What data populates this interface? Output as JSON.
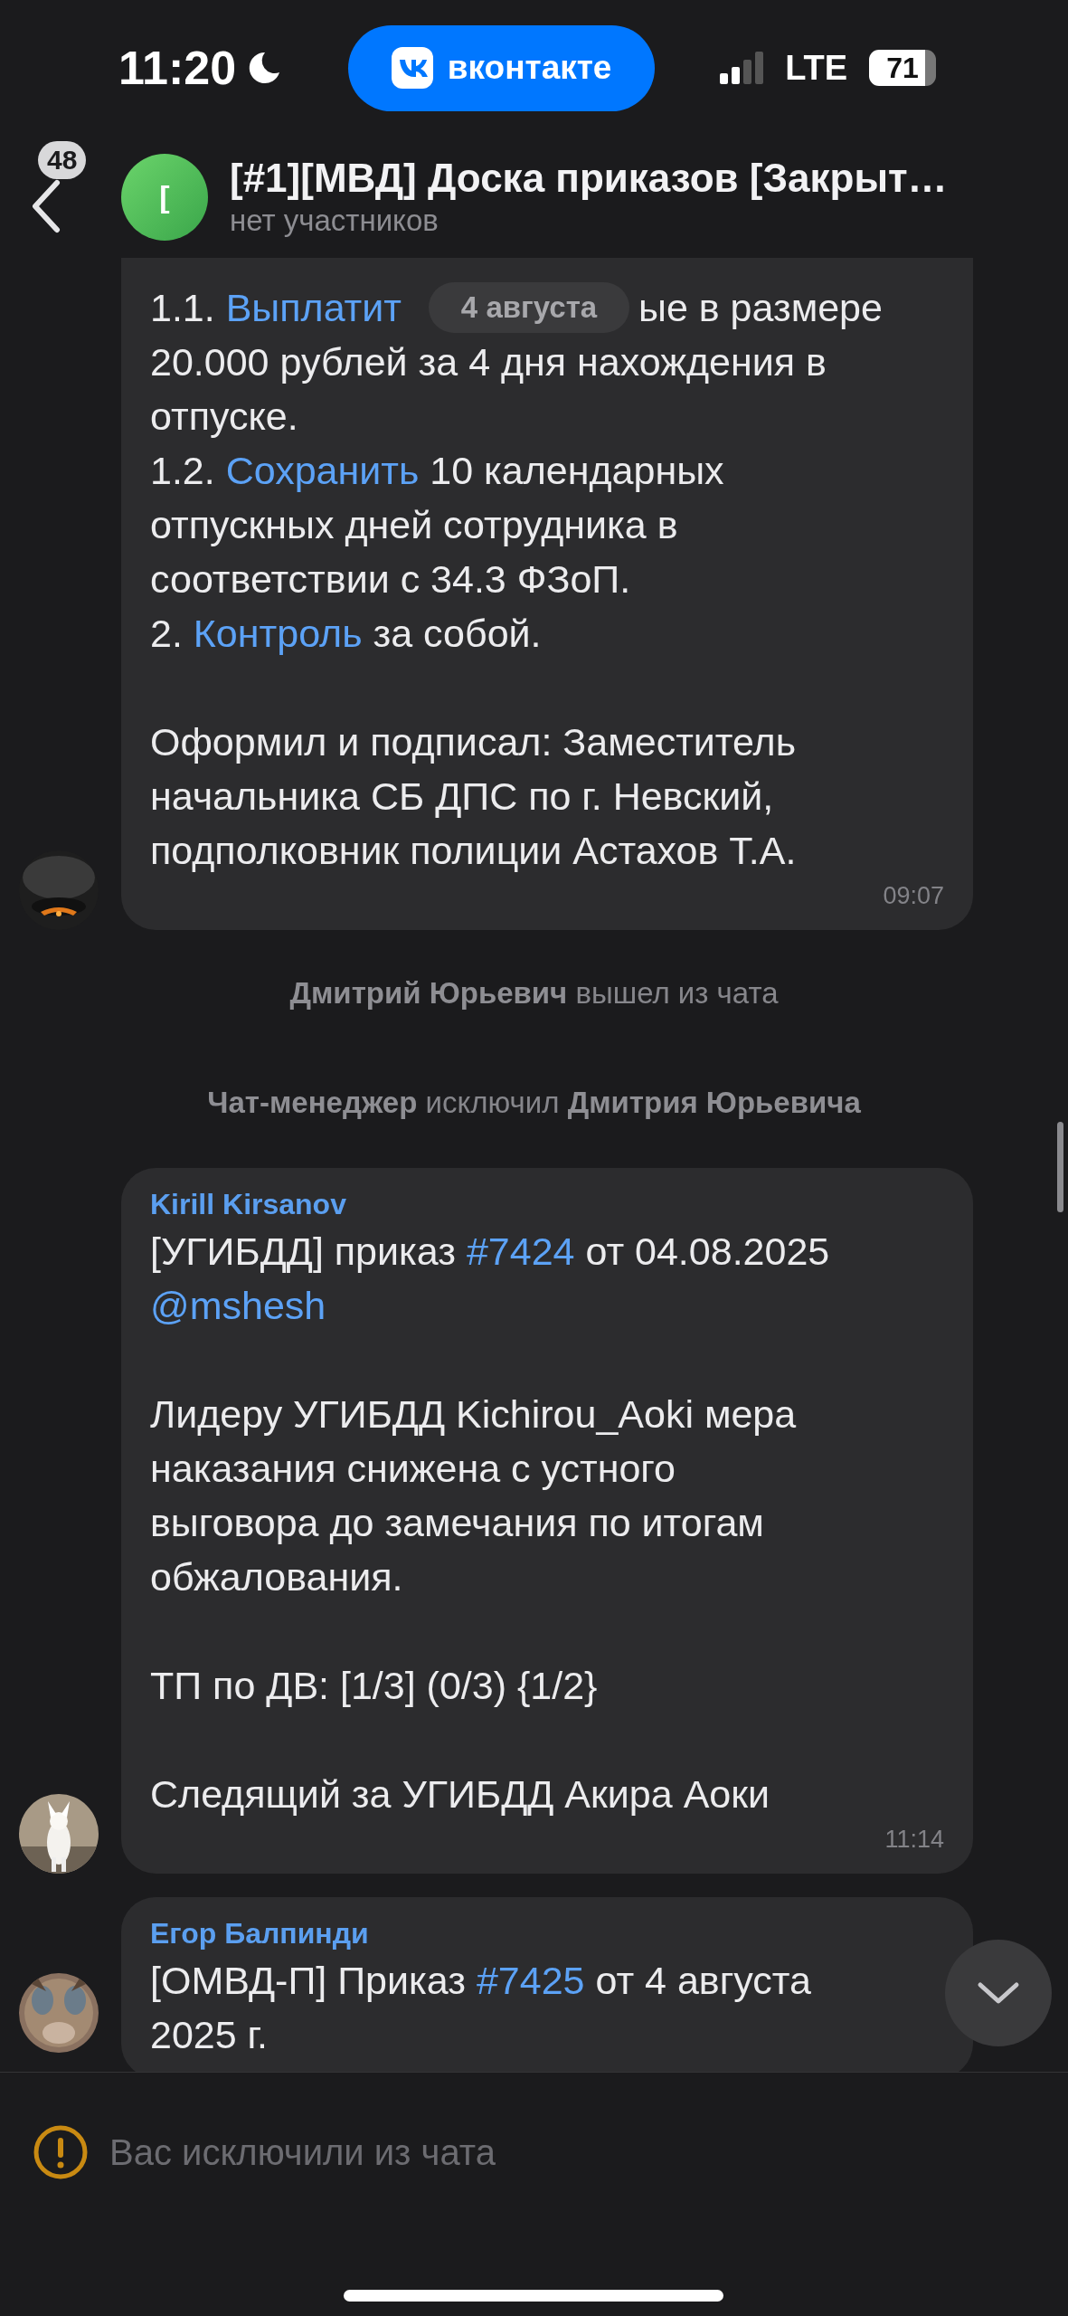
{
  "status_bar": {
    "time": "11:20",
    "app_pill": "вконтакте",
    "network": "LTE",
    "battery": "71"
  },
  "header": {
    "back_badge": "48",
    "avatar_letter": "[",
    "title": "[#1][МВД] Доска приказов [Закрыт…",
    "subtitle": "нет участников"
  },
  "date_pill": "4 августа",
  "feed": [
    {
      "kind": "message",
      "paragraphs": [
        [
          [
            {
              "kind": "text",
              "text": "1.1. "
            },
            {
              "kind": "link",
              "text": "Выплатит"
            },
            {
              "kind": "covered"
            },
            {
              "kind": "text",
              "text": "ые в размере"
            }
          ],
          [
            {
              "kind": "text",
              "text": "20.000 рублей за 4 дня нахождения в"
            }
          ],
          [
            {
              "kind": "text",
              "text": "отпуске."
            }
          ],
          [
            {
              "kind": "text",
              "text": "1.2. "
            },
            {
              "kind": "link",
              "text": "Сохранить"
            },
            {
              "kind": "text",
              "text": " 10 календарных"
            }
          ],
          [
            {
              "kind": "text",
              "text": "отпускных дней сотрудника в"
            }
          ],
          [
            {
              "kind": "text",
              "text": "соответствии с 34.3 ФЗоП."
            }
          ],
          [
            {
              "kind": "text",
              "text": "2. "
            },
            {
              "kind": "link",
              "text": "Контроль"
            },
            {
              "kind": "text",
              "text": " за собой."
            }
          ]
        ],
        [
          [
            {
              "kind": "text",
              "text": "Оформил и подписал: Заместитель"
            }
          ],
          [
            {
              "kind": "text",
              "text": "начальника СБ ДПС по г. Невский,"
            }
          ],
          [
            {
              "kind": "text",
              "text": "подполковник полиции Астахов Т.А."
            }
          ]
        ]
      ],
      "time": "09:07"
    },
    {
      "kind": "system",
      "text": "**Дмитрий Юрьевич** вышел из чата"
    },
    {
      "kind": "system",
      "text": "**Чат-менеджер** исключил **Дмитрия Юрьевича**"
    },
    {
      "kind": "message",
      "sender": "Kirill Kirsanov",
      "paragraphs": [
        [
          [
            {
              "kind": "text",
              "text": "[УГИБДД] приказ "
            },
            {
              "kind": "link",
              "text": "#7424"
            },
            {
              "kind": "text",
              "text": " от 04.08.2025"
            }
          ],
          [
            {
              "kind": "link",
              "text": "@mshesh"
            }
          ]
        ],
        [
          [
            {
              "kind": "text",
              "text": "Лидеру УГИБДД Kichirou_Aoki мера"
            }
          ],
          [
            {
              "kind": "text",
              "text": "наказания снижена с устного"
            }
          ],
          [
            {
              "kind": "text",
              "text": "выговора до замечания по итогам"
            }
          ],
          [
            {
              "kind": "text",
              "text": "обжалования."
            }
          ]
        ],
        [
          [
            {
              "kind": "text",
              "text": "ТП по ДВ: [1/3] (0/3) {1/2}"
            }
          ]
        ],
        [
          [
            {
              "kind": "text",
              "text": "Следящий за УГИБДД Акира Аоки"
            }
          ]
        ]
      ],
      "time": "11:14"
    },
    {
      "kind": "message",
      "sender": "Егор Балпинди",
      "paragraphs": [
        [
          [
            {
              "kind": "text",
              "text": "[ОМВД-П] Приказ "
            },
            {
              "kind": "link",
              "text": "#7425"
            },
            {
              "kind": "text",
              "text": " от 4 августа"
            }
          ],
          [
            {
              "kind": "text",
              "text": "2025 г."
            }
          ]
        ]
      ]
    }
  ],
  "notice": "Вас исключили из чата"
}
